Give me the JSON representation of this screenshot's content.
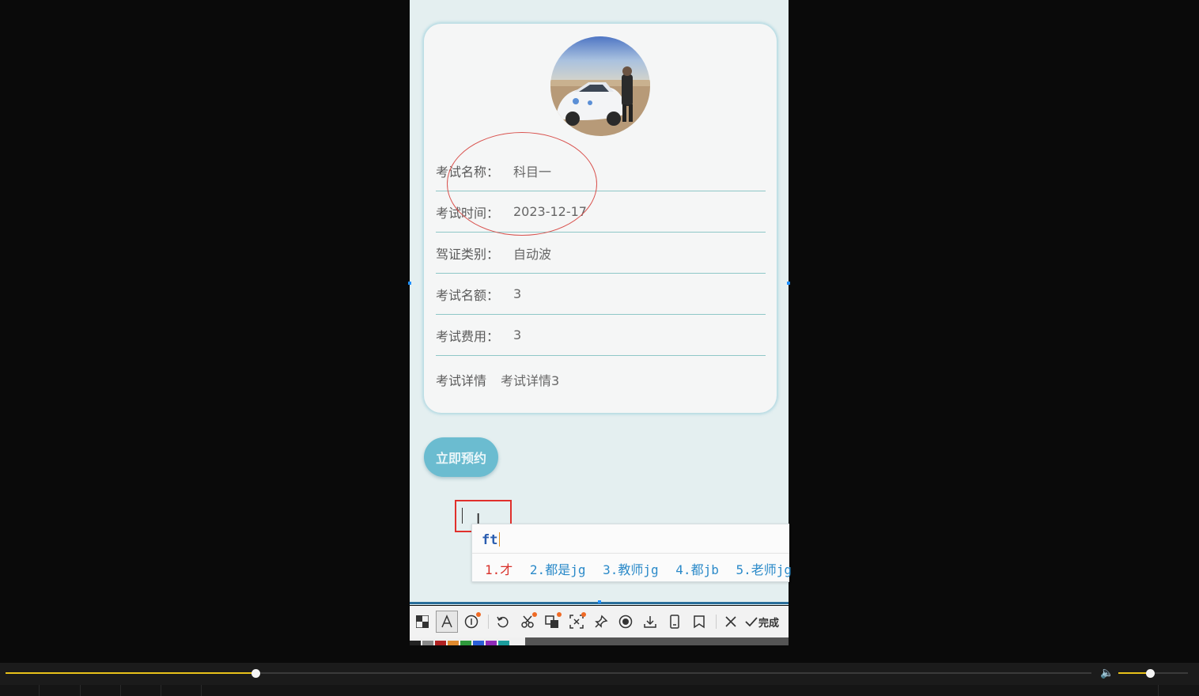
{
  "detail": {
    "rows": [
      {
        "label": "考试名称：",
        "value": "科目一"
      },
      {
        "label": "考试时间：",
        "value": "2023-12-17"
      },
      {
        "label": "驾证类别：",
        "value": "自动波"
      },
      {
        "label": "考试名额：",
        "value": "3"
      },
      {
        "label": "考试费用：",
        "value": "3"
      }
    ],
    "details_label": "考试详情",
    "details_value": "考试详情3"
  },
  "book_button": "立即预约",
  "ime": {
    "pinyin": "ft",
    "candidates": [
      "1.才",
      "2.都是jg",
      "3.教师jg",
      "4.都jb",
      "5.老师jg"
    ]
  },
  "toolbar": {
    "done_label": "完成",
    "icons": [
      "mosaic-icon",
      "text-icon",
      "number-icon",
      "undo-icon",
      "scissors-icon",
      "translate-icon",
      "screenshot-icon",
      "pin-icon",
      "record-icon",
      "download-icon",
      "save-icon",
      "bookmark-icon",
      "close-icon",
      "check-icon"
    ]
  },
  "player": {
    "progress": 0.23,
    "volume": 0.45
  },
  "colors": {
    "accent_button": "#6bbcd0",
    "annotation_red": "#d9534f",
    "progress_yellow": "#e8c21a"
  }
}
